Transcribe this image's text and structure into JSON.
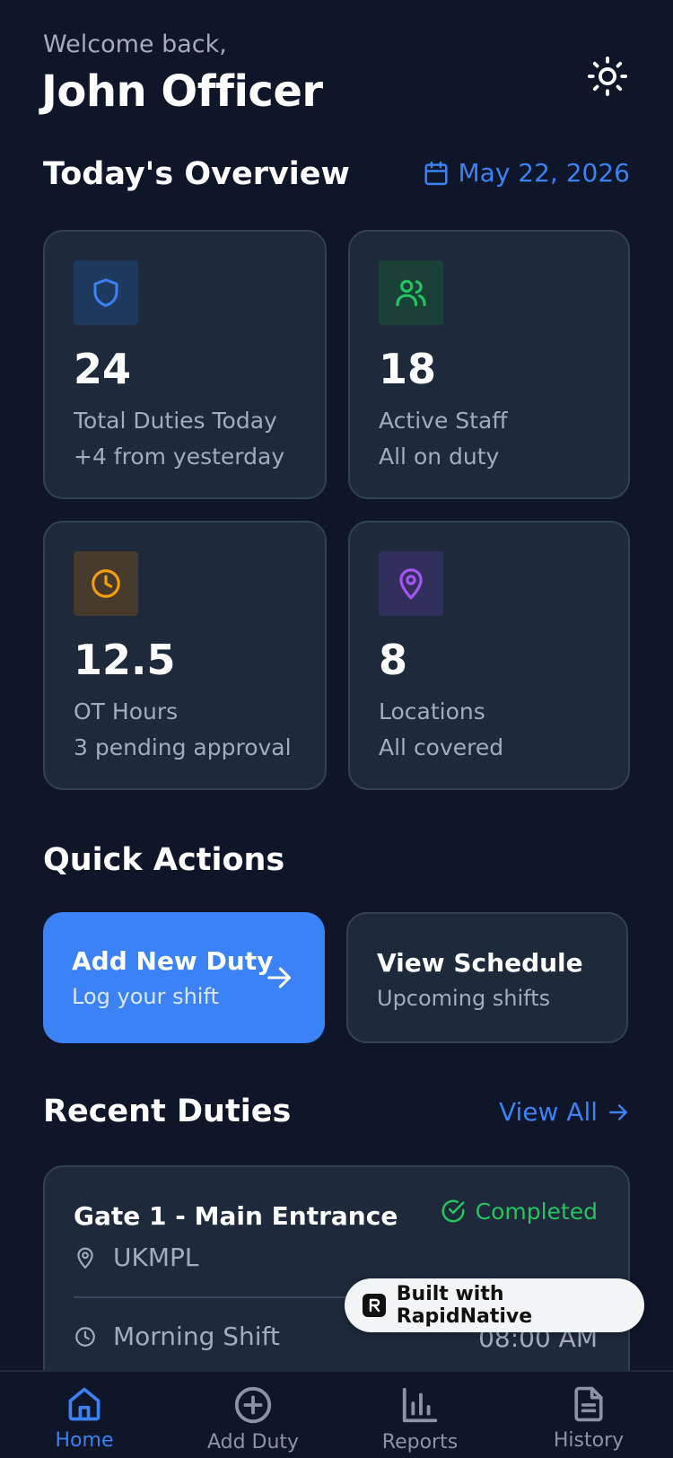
{
  "header": {
    "greeting": "Welcome back,",
    "user_name": "John Officer"
  },
  "overview": {
    "title": "Today's Overview",
    "date": "May 22, 2026"
  },
  "stats": [
    {
      "value": "24",
      "label": "Total Duties Today",
      "sub": "+4 from yesterday",
      "icon": "shield-icon",
      "color": "#3b82f6"
    },
    {
      "value": "18",
      "label": "Active Staff",
      "sub": "All on duty",
      "icon": "users-icon",
      "color": "#22c55e"
    },
    {
      "value": "12.5",
      "label": "OT Hours",
      "sub": "3 pending approval",
      "icon": "clock-icon",
      "color": "#f59e0b"
    },
    {
      "value": "8",
      "label": "Locations",
      "sub": "All covered",
      "icon": "map-pin-icon",
      "color": "#a855f7"
    }
  ],
  "quick_actions": {
    "title": "Quick Actions",
    "items": [
      {
        "label": "Add New Duty",
        "sub": "Log your shift"
      },
      {
        "label": "View Schedule",
        "sub": "Upcoming shifts"
      }
    ]
  },
  "recent": {
    "title": "Recent Duties",
    "view_all": "View All",
    "items": [
      {
        "title": "Gate 1 - Main Entrance",
        "status": "Completed",
        "location": "UKMPL",
        "shift": "Morning Shift",
        "time": "08:00 AM"
      }
    ]
  },
  "badge": {
    "text": "Built with RapidNative"
  },
  "nav": [
    {
      "label": "Home",
      "icon": "home-icon",
      "active": true
    },
    {
      "label": "Add Duty",
      "icon": "plus-circle-icon",
      "active": false
    },
    {
      "label": "Reports",
      "icon": "bar-chart-icon",
      "active": false
    },
    {
      "label": "History",
      "icon": "file-text-icon",
      "active": false
    }
  ],
  "colors": {
    "background": "#0f1629",
    "card": "#1e293b",
    "accent": "#3b82f6",
    "success": "#22c55e"
  }
}
